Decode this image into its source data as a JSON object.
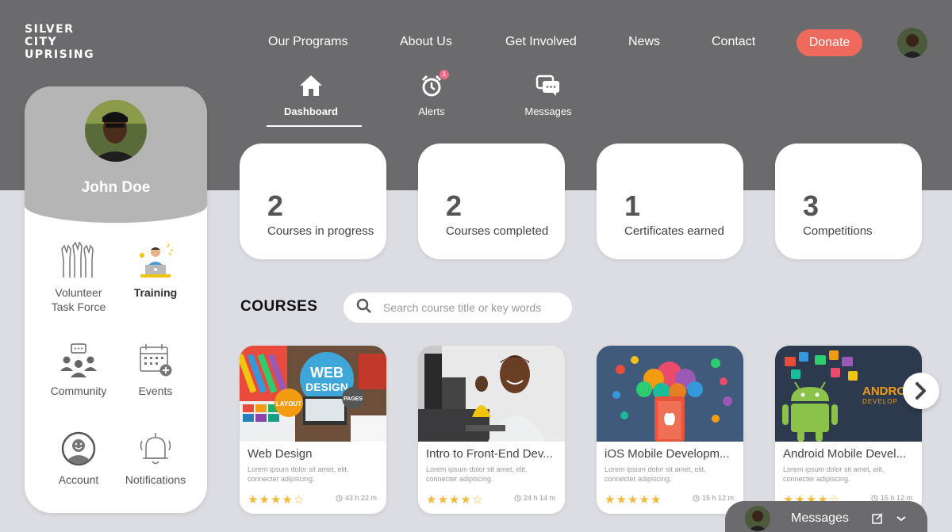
{
  "brand": {
    "line1": "SILVER",
    "line2": "CITY",
    "line3": "UPRISING"
  },
  "nav": {
    "programs": "Our Programs",
    "about": "About Us",
    "involved": "Get Involved",
    "news": "News",
    "contact": "Contact",
    "donate": "Donate"
  },
  "subtabs": {
    "dashboard": "Dashboard",
    "alerts": "Alerts",
    "alerts_badge": "1",
    "messages": "Messages"
  },
  "profile": {
    "name": "John Doe"
  },
  "sidebar": {
    "volunteer_line1": "Volunteer",
    "volunteer_line2": "Task Force",
    "training": "Training",
    "community": "Community",
    "events": "Events",
    "account": "Account",
    "notifications": "Notifications"
  },
  "stats": [
    {
      "value": "2",
      "label": "Courses in progress"
    },
    {
      "value": "2",
      "label": "Courses completed"
    },
    {
      "value": "1",
      "label": "Certificates earned"
    },
    {
      "value": "3",
      "label": "Competitions"
    }
  ],
  "courses": {
    "title": "COURSES",
    "search_placeholder": "Search course title or key words",
    "items": [
      {
        "title": "Web Design",
        "desc": "Lorem ipsum dolor sit amet, elit, connecter adipiscing.",
        "rating": 4,
        "duration": "43 h 22 m"
      },
      {
        "title": "Intro to Front-End Dev...",
        "desc": "Lorem ipsum dolor sit amet, elit, connecter adipiscing.",
        "rating": 4,
        "duration": "24 h 14 m"
      },
      {
        "title": "iOS Mobile Developm...",
        "desc": "Lorem ipsum dolor sit amet, elit, connecter adipiscing.",
        "rating": 5,
        "duration": "15 h 12 m"
      },
      {
        "title": "Android Mobile Devel...",
        "desc": "Lorem ipsum dolor sit amet, elit, connecter adipiscing.",
        "rating": 4,
        "duration": "15 h 12 m"
      }
    ],
    "thumb_text": {
      "web_line1": "WEB",
      "web_line2": "DESIGN",
      "web_layout": "LAYOUT",
      "web_pages": "PAGES",
      "android_line1": "ANDROI",
      "android_line2": "DEVELOP"
    }
  },
  "messages_bar": {
    "label": "Messages"
  },
  "colors": {
    "band": "#6b6b6d",
    "background": "#dcdde2",
    "donate": "#ee6a5d",
    "star": "#f2b93b"
  },
  "icons": [
    "home-icon",
    "alarm-clock-icon",
    "chat-bubbles-icon",
    "raised-hands-icon",
    "laptop-person-icon",
    "community-icon",
    "calendar-add-icon",
    "account-smile-icon",
    "bell-icon",
    "search-icon",
    "clock-icon",
    "chevron-right-icon",
    "edit-icon",
    "chevron-down-icon"
  ]
}
